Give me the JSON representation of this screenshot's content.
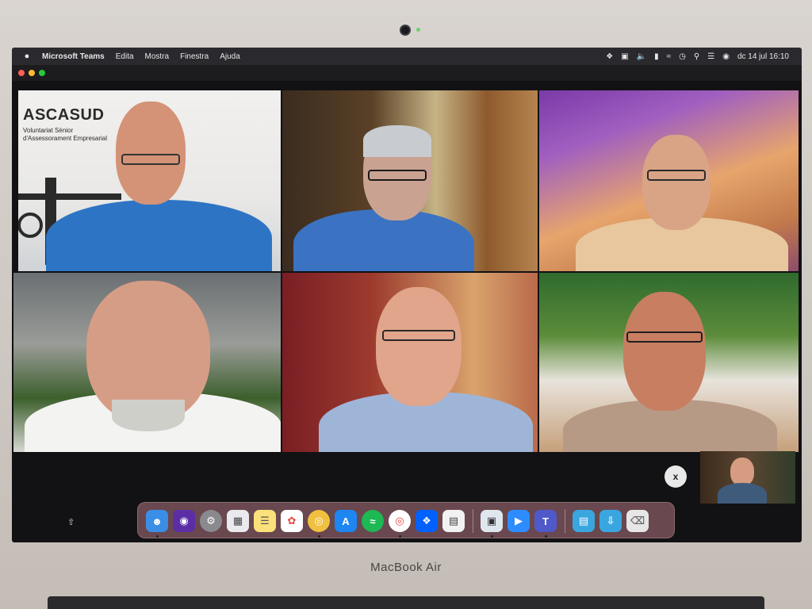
{
  "menubar": {
    "app_name": "Microsoft Teams",
    "items": [
      "Edita",
      "Mostra",
      "Finestra",
      "Ajuda"
    ],
    "datetime": "dc 14 jul  16:10",
    "status_icons": [
      "dropbox-icon",
      "screen-icon",
      "volume-icon",
      "battery-icon",
      "wifi-icon",
      "clock-icon",
      "search-icon",
      "control-center-icon",
      "siri-icon"
    ]
  },
  "window_controls": {
    "close_color": "#ff5f57",
    "minimize_color": "#febc2e",
    "zoom_color": "#28c840"
  },
  "participants": [
    {
      "background": "ASCASUD",
      "background_line1": "Voluntariat Sènior",
      "background_line2": "d'Assessorament Empresarial"
    },
    {},
    {},
    {},
    {},
    {}
  ],
  "close_button_label": "x",
  "dock": {
    "apps": [
      "finder-icon",
      "siri-icon",
      "system-preferences-icon",
      "launchpad-icon",
      "notes-icon",
      "photos-icon",
      "chrome-canary-icon",
      "app-store-icon",
      "spotify-icon",
      "chrome-icon",
      "dropbox-icon",
      "document-icon",
      "preview-icon",
      "zoom-icon",
      "teams-icon",
      "folder-icon",
      "downloads-folder-icon",
      "trash-icon"
    ]
  },
  "laptop_brand": "MacBook Air"
}
